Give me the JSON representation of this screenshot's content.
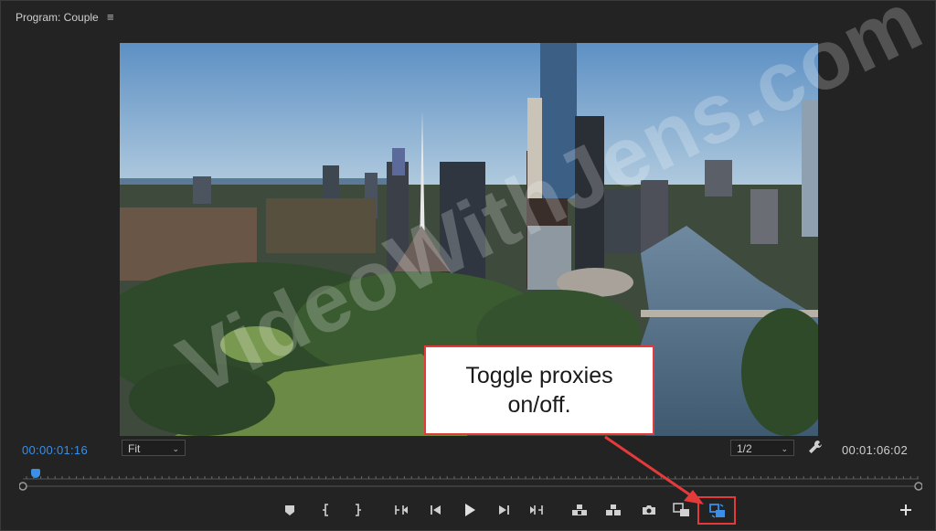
{
  "panel": {
    "title": "Program: Couple",
    "menu_icon": "hamburger-menu-icon"
  },
  "timecodes": {
    "current": "00:00:01:16",
    "duration": "00:01:06:02"
  },
  "zoom_select": {
    "value": "Fit"
  },
  "resolution_select": {
    "value": "1/2"
  },
  "callout": {
    "line1": "Toggle proxies",
    "line2": "on/off."
  },
  "watermark": "VideoWithJens.com",
  "colors": {
    "accent": "#3b8fe6",
    "highlight": "#e53a3a",
    "panel_bg": "#232323"
  },
  "controls": [
    {
      "name": "add-marker-button",
      "icon": "marker-icon"
    },
    {
      "name": "mark-in-button",
      "icon": "mark-in-icon"
    },
    {
      "name": "mark-out-button",
      "icon": "mark-out-icon"
    },
    {
      "name": "go-to-in-button",
      "icon": "go-to-in-icon"
    },
    {
      "name": "step-back-button",
      "icon": "step-back-icon"
    },
    {
      "name": "play-button",
      "icon": "play-icon"
    },
    {
      "name": "step-forward-button",
      "icon": "step-forward-icon"
    },
    {
      "name": "go-to-out-button",
      "icon": "go-to-out-icon"
    },
    {
      "name": "lift-button",
      "icon": "lift-icon"
    },
    {
      "name": "extract-button",
      "icon": "extract-icon"
    },
    {
      "name": "export-frame-button",
      "icon": "camera-icon"
    },
    {
      "name": "comparison-view-button",
      "icon": "comparison-view-icon"
    },
    {
      "name": "toggle-proxies-button",
      "icon": "toggle-proxies-icon"
    },
    {
      "name": "button-editor-button",
      "icon": "plus-icon"
    }
  ]
}
